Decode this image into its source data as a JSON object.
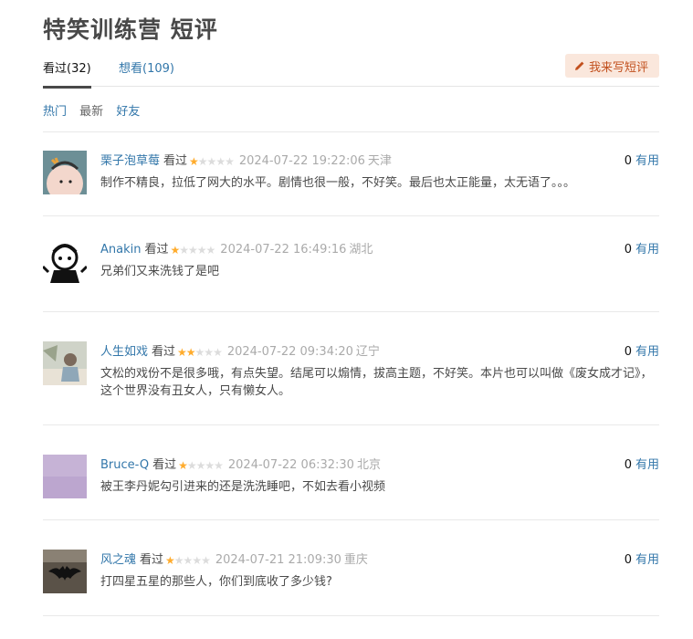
{
  "page_title": "特笑训练营 短评",
  "tabs": {
    "watched": "看过(32)",
    "want": "想看(109)"
  },
  "write_button": {
    "label": "我来写短评",
    "icon": "pencil-icon",
    "color": "#c2501e",
    "bg": "#fae7dc"
  },
  "sorts": {
    "hot": "热门",
    "new": "最新",
    "friends": "好友"
  },
  "comments": [
    {
      "user": "栗子泡草莓",
      "status": "看过",
      "rating": 1,
      "time": "2024-07-22 19:22:06",
      "location": "天津",
      "votes": "0",
      "vote_label": "有用",
      "text": "制作不精良，拉低了网大的水平。剧情也很一般，不好笑。最后也太正能量，太无语了。。。"
    },
    {
      "user": "Anakin",
      "status": "看过",
      "rating": 1,
      "time": "2024-07-22 16:49:16",
      "location": "湖北",
      "votes": "0",
      "vote_label": "有用",
      "text": "兄弟们又来洗钱了是吧"
    },
    {
      "user": "人生如戏",
      "status": "看过",
      "rating": 2,
      "time": "2024-07-22 09:34:20",
      "location": "辽宁",
      "votes": "0",
      "vote_label": "有用",
      "text": "文松的戏份不是很多哦，有点失望。结尾可以煽情，拔高主题，不好笑。本片也可以叫做《废女成才记》，这个世界没有丑女人，只有懒女人。"
    },
    {
      "user": "Bruce-Q",
      "status": "看过",
      "rating": 1,
      "time": "2024-07-22 06:32:30",
      "location": "北京",
      "votes": "0",
      "vote_label": "有用",
      "text": "被王李丹妮勾引进来的还是洗洗睡吧，不如去看小视频"
    },
    {
      "user": "风之魂",
      "status": "看过",
      "rating": 1,
      "time": "2024-07-21 21:09:30",
      "location": "重庆",
      "votes": "0",
      "vote_label": "有用",
      "text": "打四星五星的那些人，你们到底收了多少钱?"
    }
  ],
  "colors": {
    "link": "#37a",
    "star_on": "#ffac2d",
    "star_off": "#dcdcdc"
  }
}
